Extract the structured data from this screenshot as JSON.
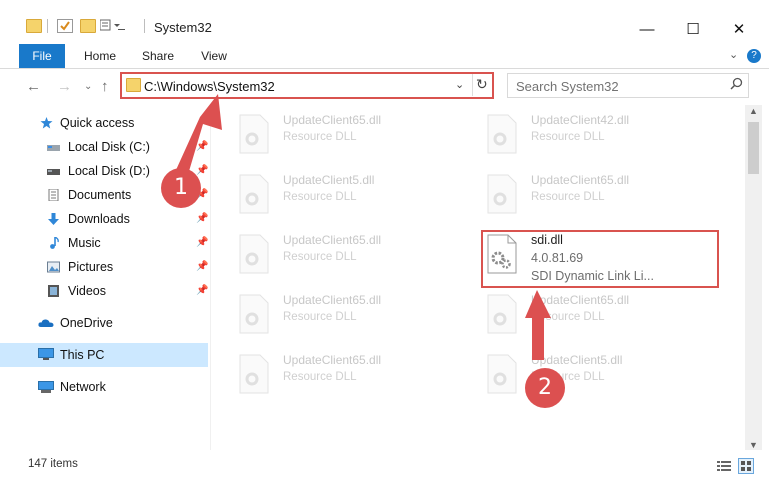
{
  "window": {
    "title": "System32",
    "minimize_glyph": "—",
    "maximize_glyph": "☐",
    "close_glyph": "✕"
  },
  "ribbon": {
    "tabs": [
      "File",
      "Home",
      "Share",
      "View"
    ]
  },
  "address": {
    "path": "C:\\Windows\\System32",
    "search_placeholder": "Search System32"
  },
  "sidebar": {
    "items": [
      {
        "label": "Quick access",
        "icon": "star-icon"
      },
      {
        "label": "Local Disk (C:)",
        "icon": "drive-icon",
        "pinned": true
      },
      {
        "label": "Local Disk (D:)",
        "icon": "drive-icon",
        "pinned": true
      },
      {
        "label": "Documents",
        "icon": "documents-icon",
        "pinned": true
      },
      {
        "label": "Downloads",
        "icon": "download-icon",
        "pinned": true
      },
      {
        "label": "Music",
        "icon": "music-icon",
        "pinned": true
      },
      {
        "label": "Pictures",
        "icon": "pictures-icon",
        "pinned": true
      },
      {
        "label": "Videos",
        "icon": "videos-icon",
        "pinned": true
      },
      {
        "label": "OneDrive",
        "icon": "cloud-icon"
      },
      {
        "label": "This PC",
        "icon": "computer-icon",
        "selected": true
      },
      {
        "label": "Network",
        "icon": "network-icon"
      }
    ]
  },
  "files": [
    {
      "name": "UpdateClient65.dll",
      "type": "Resource DLL"
    },
    {
      "name": "UpdateClient42.dll",
      "type": "Resource DLL"
    },
    {
      "name": "UpdateClient5.dll",
      "type": "Resource DLL"
    },
    {
      "name": "UpdateClient65.dll",
      "type": "Resource DLL"
    },
    {
      "name": "UpdateClient65.dll",
      "type": "Resource DLL"
    },
    {
      "name": "sdi.dll",
      "version": "4.0.81.69",
      "type": "SDI Dynamic Link Li...",
      "selected": true
    },
    {
      "name": "UpdateClient65.dll",
      "type": "Resource DLL"
    },
    {
      "name": "UpdateClient65.dll",
      "type": "Resource DLL"
    },
    {
      "name": "UpdateClient65.dll",
      "type": "Resource DLL"
    },
    {
      "name": "UpdateClient5.dll",
      "type": "Resource DLL"
    }
  ],
  "status": {
    "item_count": "147 items"
  },
  "annotations": {
    "step1": "1",
    "step2": "2"
  },
  "colors": {
    "accent": "#1979ca",
    "annotation_red": "#dc5050"
  }
}
